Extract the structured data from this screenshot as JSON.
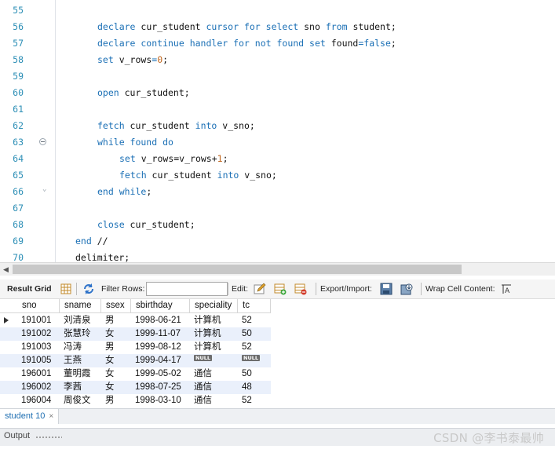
{
  "editor": {
    "lines": [
      {
        "num": "55",
        "indent": 0,
        "tokens": []
      },
      {
        "num": "56",
        "indent": 2,
        "tokens": [
          [
            "kw",
            "declare "
          ],
          [
            "id",
            "cur_student "
          ],
          [
            "kw",
            "cursor for select "
          ],
          [
            "id",
            "sno "
          ],
          [
            "kw",
            "from "
          ],
          [
            "id",
            "student;"
          ]
        ]
      },
      {
        "num": "57",
        "indent": 2,
        "tokens": [
          [
            "kw",
            "declare continue handler for not found set "
          ],
          [
            "id",
            "found"
          ],
          [
            "kw",
            "="
          ],
          [
            "kw",
            "false"
          ],
          [
            "id",
            ";"
          ]
        ]
      },
      {
        "num": "58",
        "indent": 2,
        "tokens": [
          [
            "kw",
            "set "
          ],
          [
            "id",
            "v_rows"
          ],
          [
            "kw",
            "="
          ],
          [
            "num",
            "0"
          ],
          [
            "id",
            ";"
          ]
        ]
      },
      {
        "num": "59",
        "indent": 0,
        "tokens": []
      },
      {
        "num": "60",
        "indent": 2,
        "tokens": [
          [
            "kw",
            "open "
          ],
          [
            "id",
            "cur_student;"
          ]
        ]
      },
      {
        "num": "61",
        "indent": 0,
        "tokens": []
      },
      {
        "num": "62",
        "indent": 2,
        "tokens": [
          [
            "kw",
            "fetch "
          ],
          [
            "id",
            "cur_student "
          ],
          [
            "kw",
            "into "
          ],
          [
            "id",
            "v_sno;"
          ]
        ]
      },
      {
        "num": "63",
        "indent": 2,
        "fold": "start",
        "tokens": [
          [
            "kw",
            "while found do"
          ]
        ]
      },
      {
        "num": "64",
        "indent": 3,
        "tokens": [
          [
            "kw",
            "set "
          ],
          [
            "id",
            "v_rows=v_rows+"
          ],
          [
            "num",
            "1"
          ],
          [
            "id",
            ";"
          ]
        ]
      },
      {
        "num": "65",
        "indent": 3,
        "tokens": [
          [
            "kw",
            "fetch "
          ],
          [
            "id",
            "cur_student "
          ],
          [
            "kw",
            "into "
          ],
          [
            "id",
            "v_sno;"
          ]
        ]
      },
      {
        "num": "66",
        "indent": 2,
        "fold": "end",
        "tokens": [
          [
            "kw",
            "end while"
          ],
          [
            "id",
            ";"
          ]
        ]
      },
      {
        "num": "67",
        "indent": 0,
        "tokens": []
      },
      {
        "num": "68",
        "indent": 2,
        "tokens": [
          [
            "kw",
            "close "
          ],
          [
            "id",
            "cur_student;"
          ]
        ]
      },
      {
        "num": "69",
        "indent": 1,
        "tokens": [
          [
            "kw",
            "end "
          ],
          [
            "id",
            "//"
          ]
        ]
      },
      {
        "num": "70",
        "indent": 1,
        "tokens": [
          [
            "id",
            "delimiter;"
          ]
        ]
      }
    ]
  },
  "toolbar": {
    "result_grid_label": "Result Grid",
    "filter_rows_label": "Filter Rows:",
    "filter_rows_value": "",
    "edit_label": "Edit:",
    "export_import_label": "Export/Import:",
    "wrap_cell_label": "Wrap Cell Content:"
  },
  "grid": {
    "columns": [
      "sno",
      "sname",
      "ssex",
      "sbirthday",
      "speciality",
      "tc"
    ],
    "null_text": "NULL",
    "rows": [
      [
        "191001",
        "刘清泉",
        "男",
        "1998-06-21",
        "计算机",
        "52"
      ],
      [
        "191002",
        "张慧玲",
        "女",
        "1999-11-07",
        "计算机",
        "50"
      ],
      [
        "191003",
        "冯涛",
        "男",
        "1999-08-12",
        "计算机",
        "52"
      ],
      [
        "191005",
        "王燕",
        "女",
        "1999-04-17",
        null,
        null
      ],
      [
        "196001",
        "董明霞",
        "女",
        "1999-05-02",
        "通信",
        "50"
      ],
      [
        "196002",
        "李茜",
        "女",
        "1998-07-25",
        "通信",
        "48"
      ],
      [
        "196004",
        "周俊文",
        "男",
        "1998-03-10",
        "通信",
        "52"
      ]
    ]
  },
  "tabs": {
    "result_tab_label": "student 10",
    "close_glyph": "×",
    "output_label": "Output"
  },
  "watermark": "CSDN @李书泰最帅"
}
